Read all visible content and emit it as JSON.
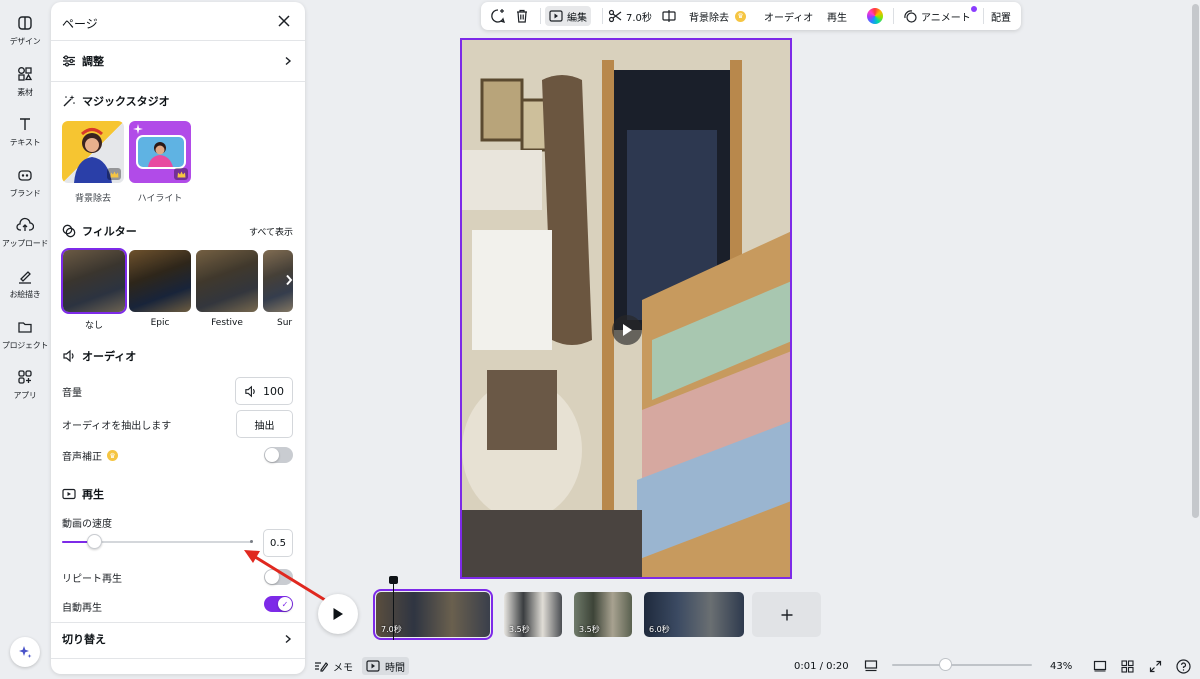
{
  "rail": [
    {
      "label": "デザイン",
      "icon": "design-icon"
    },
    {
      "label": "素材",
      "icon": "elements-icon"
    },
    {
      "label": "テキスト",
      "icon": "text-icon"
    },
    {
      "label": "ブランド",
      "icon": "brand-icon"
    },
    {
      "label": "アップロード",
      "icon": "upload-icon"
    },
    {
      "label": "お絵描き",
      "icon": "draw-icon"
    },
    {
      "label": "プロジェクト",
      "icon": "folder-icon"
    },
    {
      "label": "アプリ",
      "icon": "apps-icon"
    }
  ],
  "panel": {
    "title": "ページ",
    "adjust": "調整",
    "magic_studio": "マジックスタジオ",
    "magic_items": [
      {
        "label": "背景除去"
      },
      {
        "label": "ハイライト"
      }
    ],
    "filters_title": "フィルター",
    "filters_show_all": "すべて表示",
    "filters": [
      "なし",
      "Epic",
      "Festive",
      "Sur"
    ],
    "audio_title": "オーディオ",
    "volume_label": "音量",
    "volume_value": "100",
    "extract_label": "オーディオを抽出します",
    "extract_button": "抽出",
    "enhance_label": "音声補正",
    "playback_title": "再生",
    "speed_label": "動画の速度",
    "speed_value": "0.5",
    "speed_fraction": 0.17,
    "repeat_label": "リピート再生",
    "repeat_on": false,
    "autoplay_label": "自動再生",
    "autoplay_on": true,
    "transition_label": "切り替え"
  },
  "toolbar": {
    "edit": "編集",
    "duration": "7.0秒",
    "bg_remove": "背景除去",
    "audio": "オーディオ",
    "playback": "再生",
    "animate": "アニメート",
    "position": "配置"
  },
  "timeline": {
    "clips": [
      {
        "label": "7.0秒",
        "selected": true
      },
      {
        "label": "3.5秒",
        "selected": false
      },
      {
        "label": "3.5秒",
        "selected": false
      },
      {
        "label": "6.0秒",
        "selected": false
      }
    ]
  },
  "bottom": {
    "notes": "メモ",
    "time_mode": "時間",
    "time": "0:01 / 0:20",
    "zoom": "43%",
    "zoom_fraction": 0.38
  },
  "colors": {
    "accent": "#7d2ae8",
    "annotation_arrow": "#e0281f"
  }
}
